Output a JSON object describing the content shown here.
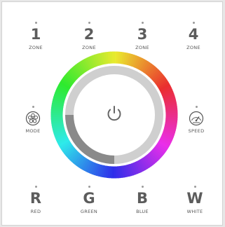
{
  "zones": [
    {
      "number": "1",
      "label": "ZONE"
    },
    {
      "number": "2",
      "label": "ZONE"
    },
    {
      "number": "3",
      "label": "ZONE"
    },
    {
      "number": "4",
      "label": "ZONE"
    }
  ],
  "mode": {
    "label": "MODE",
    "icon": "flower-icon"
  },
  "speed": {
    "label": "SPEED",
    "icon": "speedometer-icon"
  },
  "power": {
    "icon": "power-icon"
  },
  "channels": [
    {
      "letter": "R",
      "label": "RED"
    },
    {
      "letter": "G",
      "label": "GREEN"
    },
    {
      "letter": "B",
      "label": "BLUE"
    },
    {
      "letter": "W",
      "label": "WHITE"
    }
  ],
  "colors": {
    "panel": "#ffffff",
    "text": "#555555",
    "inner_ring": "#cfcfcf",
    "inner_ring_dark": "#8a8a8a"
  }
}
